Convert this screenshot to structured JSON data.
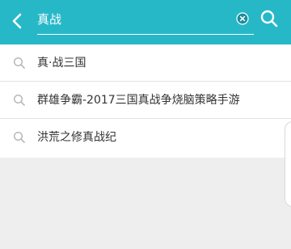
{
  "search": {
    "value": "真战"
  },
  "suggestions": [
    {
      "label": "真·战三国"
    },
    {
      "label": "群雄争霸-2017三国真战争烧脑策略手游"
    },
    {
      "label": "洪荒之修真战纪"
    }
  ],
  "icons": {
    "back": "back-arrow-icon",
    "clear": "clear-icon",
    "search": "search-icon",
    "suggestion": "search-icon"
  },
  "colors": {
    "toolbar": "#27b8c8",
    "text": "#333333",
    "background": "#eeeeee"
  }
}
